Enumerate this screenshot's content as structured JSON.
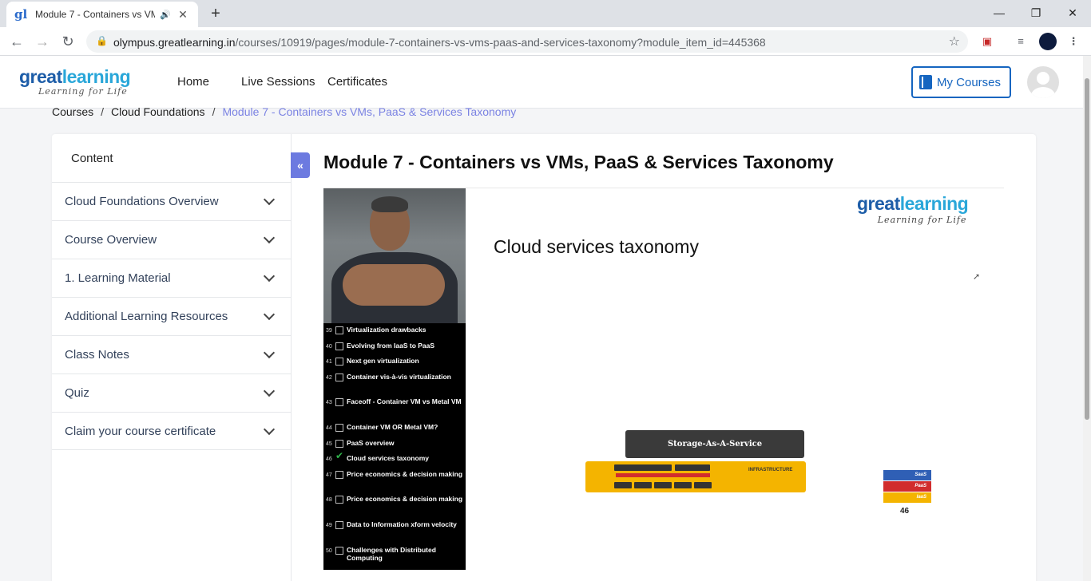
{
  "browser": {
    "tab_title": "Module 7 - Containers vs VMs, PaaS & Services Taxonomy",
    "favicon": "gl",
    "url_host": "olympus.greatlearning.in",
    "url_path": "/courses/10919/pages/module-7-containers-vs-vms-paas-and-services-taxonomy?module_item_id=445368"
  },
  "header": {
    "logo_great": "great",
    "logo_learning": "learning",
    "logo_tagline": "Learning for Life",
    "nav": [
      "Home",
      "Live Sessions",
      "Certificates"
    ],
    "my_courses": "My Courses"
  },
  "breadcrumb": {
    "items": [
      "Courses",
      "Cloud Foundations"
    ],
    "separator": "/",
    "current": "Module 7 - Containers vs VMs, PaaS & Services Taxonomy"
  },
  "sidebar": {
    "heading": "Content",
    "collapse_glyph": "«",
    "items": [
      "Cloud Foundations Overview",
      "Course Overview",
      "1. Learning Material",
      "Additional Learning Resources",
      "Class Notes",
      "Quiz",
      "Claim your course certificate"
    ]
  },
  "page": {
    "title": "Module 7 - Containers vs VMs, PaaS & Services Taxonomy"
  },
  "video": {
    "toc": [
      {
        "num": "39",
        "label": "Virtualization drawbacks",
        "checked": false
      },
      {
        "num": "40",
        "label": "Evolving from IaaS to PaaS",
        "checked": false
      },
      {
        "num": "41",
        "label": "Next gen virtualization",
        "checked": false
      },
      {
        "num": "42",
        "label": "Container vis-à-vis virtualization",
        "checked": false
      },
      {
        "num": "43",
        "label": "Faceoff - Container VM vs Metal VM",
        "checked": false
      },
      {
        "num": "44",
        "label": "Container VM OR Metal VM?",
        "checked": false
      },
      {
        "num": "45",
        "label": "PaaS overview",
        "checked": false
      },
      {
        "num": "46",
        "label": "Cloud services taxonomy",
        "checked": true
      },
      {
        "num": "47",
        "label": "Price economics & decision making",
        "checked": false
      },
      {
        "num": "48",
        "label": "Price economics & decision making",
        "checked": false
      },
      {
        "num": "49",
        "label": "Data to Information xform velocity",
        "checked": false
      },
      {
        "num": "50",
        "label": "Challenges with Distributed Computing",
        "checked": false
      }
    ],
    "slide": {
      "logo_great": "great",
      "logo_learning": "learning",
      "logo_tagline": "Learning for Life",
      "title": "Cloud services taxonomy",
      "storage_label": "Storage-As-A-Service",
      "infra_label": "INFRASTRUCTURE",
      "layers": [
        "SaaS",
        "PaaS",
        "IaaS"
      ],
      "layer_colors": [
        "#2f5fb5",
        "#d12d2d",
        "#f4b400"
      ],
      "slide_number": "46"
    }
  }
}
